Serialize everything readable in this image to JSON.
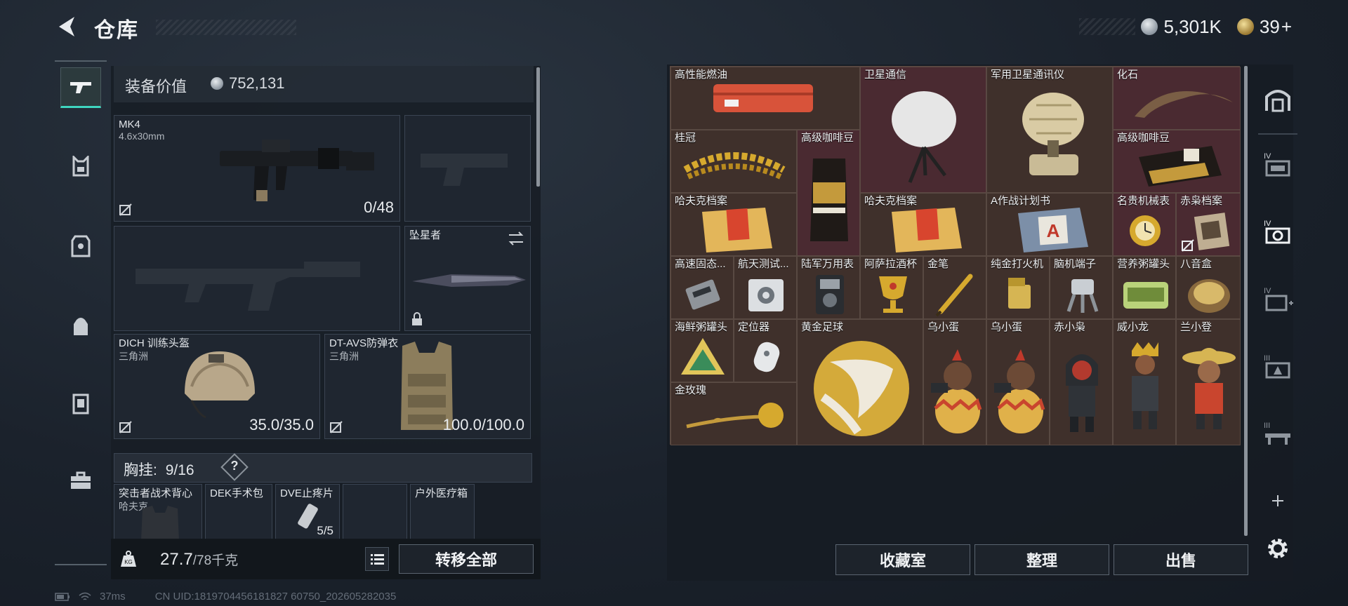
{
  "header": {
    "title": "仓库",
    "currency_silver": "5,301K",
    "currency_gold": "39",
    "currency_gold_plus": "+"
  },
  "left_nav": {
    "items": [
      "rifle-icon",
      "gear-vest-icon",
      "armor-icon",
      "backpack-icon",
      "container-icon",
      "case-icon"
    ],
    "active_index": 0
  },
  "loadout": {
    "equip_label": "装备价值",
    "equip_value": "752,131",
    "slots": {
      "primary": {
        "name": "MK4",
        "sub": "4.6x30mm",
        "value": "0/48"
      },
      "helmet": {
        "name": "DICH 训练头盔",
        "sub": "三角洲",
        "value": "35.0/35.0"
      },
      "armor": {
        "name": "DT-AVS防弹衣",
        "sub": "三角洲",
        "value": "100.0/100.0"
      },
      "melee": {
        "name": "坠星者"
      }
    },
    "chest_rig_label": "胸挂:",
    "chest_rig_value": "9/16",
    "chest_help": "?",
    "pouch_items": [
      {
        "name": "突击者战术背心",
        "sub": "哈夫克"
      },
      {
        "name": "DEK手术包"
      },
      {
        "name": "DVE止疼片",
        "value": "5/5"
      },
      {
        "name": ""
      },
      {
        "name": "户外医疗箱"
      }
    ],
    "weight_value": "27.7",
    "weight_max": "/78千克",
    "transfer_all": "转移全部"
  },
  "stash_grid": {
    "cells": [
      {
        "name": "高性能燃油",
        "icon": "fuel-case-icon",
        "color": "brown"
      },
      {
        "name": "卫星通信",
        "icon": "satellite-dish-icon",
        "color": "red"
      },
      {
        "name": "军用卫星通讯仪",
        "icon": "military-satellite-icon",
        "color": "brown"
      },
      {
        "name": "化石",
        "icon": "fossil-claw-icon",
        "color": "red"
      },
      {
        "name": "桂冠",
        "icon": "laurel-crown-icon",
        "color": "brown"
      },
      {
        "name": "高级咖啡豆",
        "icon": "coffee-bag-icon",
        "color": "red"
      },
      {
        "name": "高级咖啡豆",
        "icon": "coffee-bag-icon",
        "color": "red"
      },
      {
        "name": "哈夫克档案",
        "icon": "file-folder-icon",
        "color": "brown"
      },
      {
        "name": "哈夫克档案",
        "icon": "file-folder-icon",
        "color": "brown"
      },
      {
        "name": "A作战计划书",
        "icon": "plan-folder-icon",
        "color": "brown"
      },
      {
        "name": "名贵机械表",
        "icon": "watch-icon",
        "color": "red"
      },
      {
        "name": "赤枭档案",
        "icon": "document-icon",
        "color": "red"
      },
      {
        "name": "高速固态...",
        "icon": "ssd-icon",
        "color": "brown"
      },
      {
        "name": "航天测试...",
        "icon": "test-device-icon",
        "color": "brown"
      },
      {
        "name": "陆军万用表",
        "icon": "multimeter-icon",
        "color": "brown"
      },
      {
        "name": "阿萨拉酒杯",
        "icon": "goblet-icon",
        "color": "brown"
      },
      {
        "name": "金笔",
        "icon": "gold-pen-icon",
        "color": "brown"
      },
      {
        "name": "纯金打火机",
        "icon": "lighter-icon",
        "color": "brown"
      },
      {
        "name": "脑机端子",
        "icon": "brain-terminal-icon",
        "color": "brown"
      },
      {
        "name": "营养粥罐头",
        "icon": "tin-can-icon",
        "color": "brown"
      },
      {
        "name": "八音盒",
        "icon": "music-box-icon",
        "color": "brown"
      },
      {
        "name": "海鲜粥罐头",
        "icon": "triangle-can-icon",
        "color": "brown"
      },
      {
        "name": "定位器",
        "icon": "tracker-icon",
        "color": "brown"
      },
      {
        "name": "黄金足球",
        "icon": "golden-ball-icon",
        "color": "brown"
      },
      {
        "name": "乌小蛋",
        "icon": "egg-figure-icon",
        "color": "brown"
      },
      {
        "name": "乌小蛋",
        "icon": "egg-figure-icon",
        "color": "brown"
      },
      {
        "name": "赤小枭",
        "icon": "hooded-figure-icon",
        "color": "brown"
      },
      {
        "name": "威小龙",
        "icon": "crowned-figure-icon",
        "color": "brown"
      },
      {
        "name": "兰小登",
        "icon": "sombrero-figure-icon",
        "color": "brown"
      },
      {
        "name": "金玫瑰",
        "icon": "gold-rose-icon",
        "color": "brown"
      }
    ]
  },
  "bottom_buttons": [
    "收藏室",
    "整理",
    "出售"
  ],
  "right_nav": {
    "items": [
      "warehouse-icon",
      "iv-storage-icon",
      "iv-camera-icon",
      "iv-add-icon",
      "iii-tri-icon",
      "iii-desk-icon",
      "add-icon",
      "settings-icon"
    ]
  },
  "footer": {
    "ping": "37ms",
    "uid": "CN UID:1819704456181827 60750_202605282035"
  },
  "colors": {
    "accent": "#3fd6bf",
    "cell_brown": "#3f302b",
    "cell_red": "#4a2a31"
  }
}
